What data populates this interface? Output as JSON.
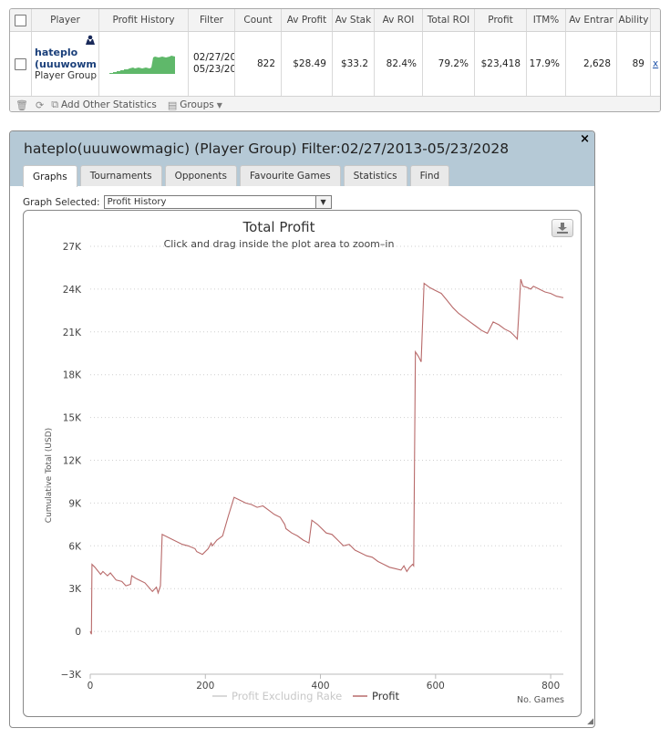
{
  "table": {
    "headers": [
      "Player",
      "Profit History",
      "Filter",
      "Count",
      "Av Profit",
      "Av Stak",
      "Av ROI",
      "Total ROI",
      "Profit",
      "ITM%",
      "Av Entrar",
      "Ability"
    ],
    "row": {
      "name_line1": "hateplo",
      "name_line2": "(uuuwowm",
      "name_line3": "Player Group",
      "filter_line1": "02/27/20",
      "filter_line2": "05/23/20",
      "count": "822",
      "av_profit": "$28.49",
      "av_stake": "$33.2",
      "av_roi": "82.4%",
      "total_roi": "79.2%",
      "profit": "$23,418",
      "itm": "17.9%",
      "av_entrants": "2,628",
      "ability": "89",
      "link": "x"
    },
    "footer": {
      "add_stats": "Add Other Statistics",
      "groups": "Groups"
    }
  },
  "dialog": {
    "title": "hateplo(uuuwowmagic) (Player Group) Filter:02/27/2013-05/23/2028",
    "close": "×",
    "tabs": [
      "Graphs",
      "Tournaments",
      "Opponents",
      "Favourite Games",
      "Statistics",
      "Find"
    ],
    "active_tab": "Graphs",
    "graph_selected_label": "Graph Selected:",
    "graph_selected_value": "Profit History"
  },
  "colors": {
    "header_bg": "#b5c9d6",
    "profit_line": "#b86a6a",
    "rake_line": "#cccccc",
    "mini_chart": "#5fb86a",
    "link": "#1a3f7a"
  },
  "chart_data": {
    "type": "line",
    "title": "Total Profit",
    "subtitle": "Click and drag inside the plot area to zoom–in",
    "ylabel": "Cumulative Total (USD)",
    "xlabel": "No. Games",
    "xlim": [
      0,
      822
    ],
    "ylim": [
      -3000,
      27000
    ],
    "x_ticks": [
      0,
      200,
      400,
      600,
      800
    ],
    "y_ticks": [
      -3000,
      0,
      3000,
      6000,
      9000,
      12000,
      15000,
      18000,
      21000,
      24000,
      27000
    ],
    "y_tick_labels": [
      "−3K",
      "0",
      "3K",
      "6K",
      "9K",
      "12K",
      "15K",
      "18K",
      "21K",
      "24K",
      "27K"
    ],
    "legend": {
      "position": "bottom",
      "entries": [
        "Profit Excluding Rake",
        "Profit"
      ]
    },
    "grid": true,
    "series": [
      {
        "name": "Profit",
        "x": [
          0,
          2,
          3,
          8,
          18,
          22,
          30,
          35,
          45,
          55,
          62,
          70,
          72,
          80,
          95,
          108,
          115,
          118,
          122,
          125,
          140,
          160,
          170,
          182,
          185,
          195,
          205,
          210,
          212,
          220,
          230,
          240,
          250,
          260,
          270,
          280,
          290,
          300,
          310,
          320,
          330,
          338,
          340,
          350,
          360,
          370,
          380,
          385,
          395,
          410,
          420,
          430,
          440,
          450,
          460,
          470,
          480,
          490,
          500,
          510,
          520,
          530,
          540,
          545,
          550,
          555,
          560,
          562,
          565,
          570,
          575,
          580,
          590,
          600,
          610,
          620,
          630,
          640,
          650,
          660,
          670,
          680,
          690,
          700,
          710,
          720,
          730,
          735,
          740,
          742,
          748,
          752,
          760,
          765,
          770,
          780,
          790,
          800,
          810,
          822
        ],
        "y": [
          0,
          -200,
          4700,
          4500,
          4000,
          4200,
          3900,
          4100,
          3600,
          3500,
          3200,
          3300,
          3900,
          3700,
          3400,
          2800,
          3100,
          2700,
          3200,
          6800,
          6500,
          6100,
          6000,
          5800,
          5600,
          5400,
          5800,
          6200,
          6000,
          6400,
          6700,
          8100,
          9400,
          9200,
          9000,
          8900,
          8700,
          8800,
          8500,
          8200,
          8000,
          7500,
          7200,
          6900,
          6700,
          6400,
          6200,
          7800,
          7500,
          6900,
          6800,
          6400,
          6000,
          6100,
          5700,
          5500,
          5300,
          5200,
          4900,
          4700,
          4500,
          4400,
          4300,
          4600,
          4200,
          4500,
          4700,
          4600,
          19600,
          19300,
          18900,
          24400,
          24100,
          23900,
          23700,
          23200,
          22700,
          22300,
          22000,
          21700,
          21400,
          21100,
          20900,
          21700,
          21500,
          21200,
          21000,
          20800,
          20600,
          20500,
          24700,
          24200,
          24100,
          24000,
          24200,
          24000,
          23800,
          23700,
          23500,
          23400
        ]
      }
    ]
  }
}
